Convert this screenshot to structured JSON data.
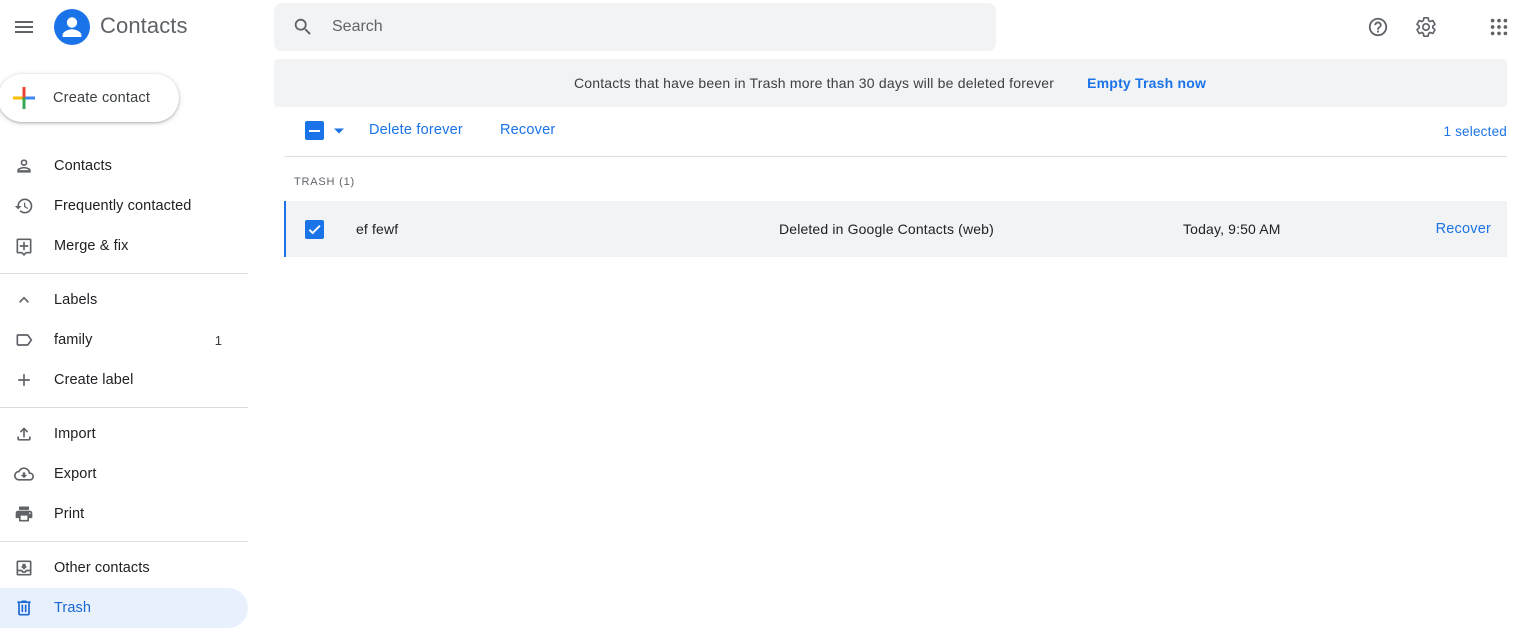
{
  "header": {
    "app_title": "Contacts",
    "search_placeholder": "Search",
    "search_value": ""
  },
  "sidebar": {
    "create_label": "Create contact",
    "items": [
      {
        "label": "Contacts",
        "icon": "person-icon"
      },
      {
        "label": "Frequently contacted",
        "icon": "history-icon"
      },
      {
        "label": "Merge & fix",
        "icon": "merge-fix-icon"
      }
    ],
    "labels_header": "Labels",
    "labels": [
      {
        "label": "family",
        "count": "1",
        "icon": "label-icon"
      }
    ],
    "create_label_item": "Create label",
    "tools": [
      {
        "label": "Import",
        "icon": "upload-icon"
      },
      {
        "label": "Export",
        "icon": "cloud-download-icon"
      },
      {
        "label": "Print",
        "icon": "print-icon"
      }
    ],
    "other_contacts": "Other contacts",
    "trash": "Trash"
  },
  "banner": {
    "message": "Contacts that have been in Trash more than 30 days will be deleted forever",
    "action": "Empty Trash now"
  },
  "toolbar": {
    "delete_forever": "Delete forever",
    "recover": "Recover",
    "selected_count": "1 selected"
  },
  "trash_list": {
    "title": "TRASH (1)",
    "rows": [
      {
        "name": "ef fewf",
        "source": "Deleted in Google Contacts (web)",
        "time": "Today, 9:50 AM",
        "action": "Recover",
        "checked": true
      }
    ]
  },
  "colors": {
    "accent": "#1a73e8",
    "active_bg": "#e8f0fe",
    "surface": "#f1f3f4",
    "icon_gray": "#5f6368"
  }
}
